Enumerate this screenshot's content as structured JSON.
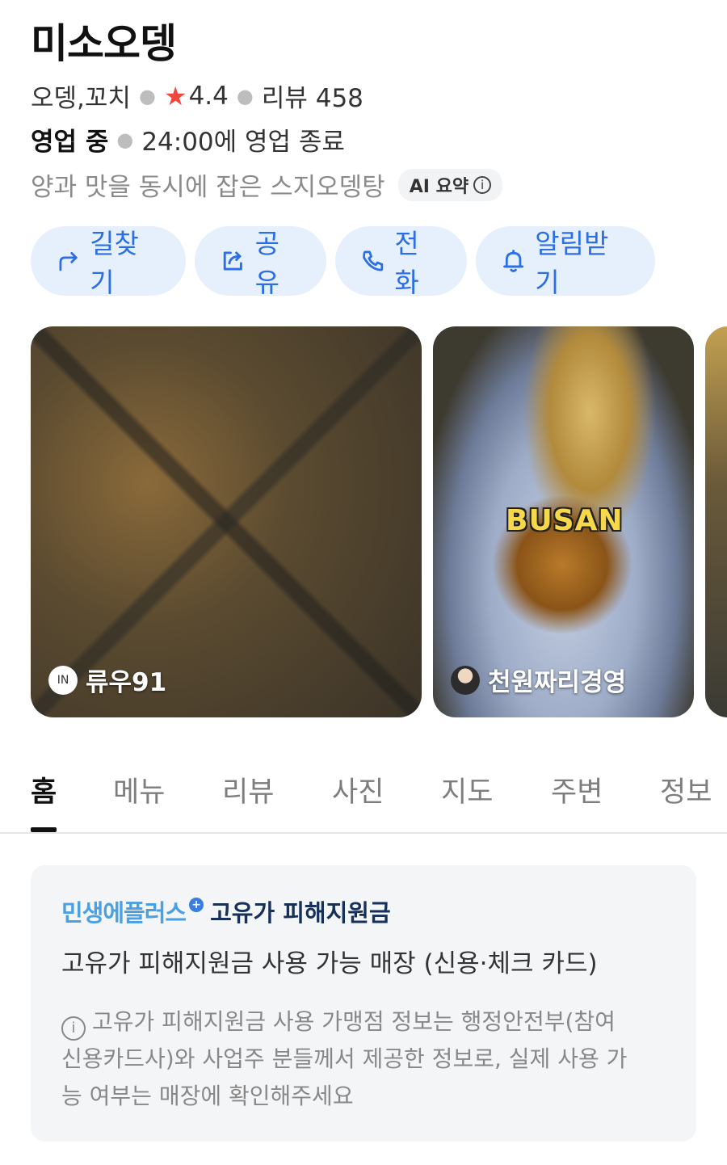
{
  "place": {
    "name": "미소오뎅",
    "category": "오뎅,꼬치",
    "rating": "4.4",
    "review_label": "리뷰 458",
    "status": "영업 중",
    "hours": "24:00에 영업 종료",
    "summary": "양과 맛을 동시에 잡은 스지오뎅탕",
    "ai_badge": "AI 요약",
    "info_glyph": "i"
  },
  "actions": [
    {
      "label": "길찾기",
      "icon": "directions-icon"
    },
    {
      "label": "공유",
      "icon": "share-icon"
    },
    {
      "label": "전화",
      "icon": "phone-icon"
    },
    {
      "label": "알림받기",
      "icon": "bell-icon"
    }
  ],
  "photos": [
    {
      "credit": "류우91",
      "avatar_text": "IN"
    },
    {
      "credit": "천원짜리경영",
      "overlay_text": "BUSAN"
    }
  ],
  "tabs": [
    "홈",
    "메뉴",
    "리뷰",
    "사진",
    "지도",
    "주변",
    "정보"
  ],
  "active_tab": "홈",
  "notice": {
    "brand_part1": "민생에플러스",
    "brand_plus": "+",
    "brand_part2": "고유가 피해지원금",
    "main": "고유가 피해지원금 사용 가능 매장 (신용·체크 카드)",
    "line1": "고유가 피해지원금 사용 가맹점 정보는 행정안전부(참여",
    "line2": "신용카드사)와 사업주 분들께서 제공한 정보로, 실제 사용 가",
    "line3": "능 여부는 매장에 확인해주세요"
  },
  "colors": {
    "accent": "#2b6ee6",
    "action_bg": "#e6f0fd",
    "star": "#f0483e"
  }
}
